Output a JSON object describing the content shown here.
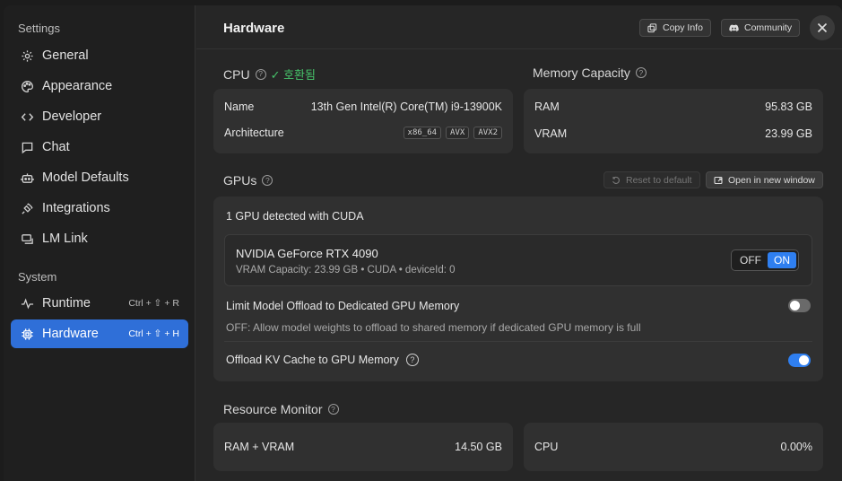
{
  "sidebar": {
    "settings_heading": "Settings",
    "system_heading": "System",
    "items": [
      {
        "label": "General",
        "icon": "gear-icon"
      },
      {
        "label": "Appearance",
        "icon": "palette-icon"
      },
      {
        "label": "Developer",
        "icon": "code-icon"
      },
      {
        "label": "Chat",
        "icon": "chat-icon"
      },
      {
        "label": "Model Defaults",
        "icon": "robot-icon"
      },
      {
        "label": "Integrations",
        "icon": "plug-icon"
      },
      {
        "label": "LM Link",
        "icon": "link-icon"
      }
    ],
    "system_items": [
      {
        "label": "Runtime",
        "shortcut": "Ctrl + ⇧ + R",
        "icon": "pulse-icon"
      },
      {
        "label": "Hardware",
        "shortcut": "Ctrl + ⇧ + H",
        "icon": "chip-icon",
        "active": true
      }
    ]
  },
  "header": {
    "title": "Hardware",
    "copy_info_label": "Copy Info",
    "community_label": "Community"
  },
  "cpu": {
    "title": "CPU",
    "status": "✓ 호환됨",
    "name_label": "Name",
    "name_value": "13th Gen Intel(R) Core(TM) i9-13900K",
    "arch_label": "Architecture",
    "arch_tags": [
      "x86_64",
      "AVX",
      "AVX2"
    ]
  },
  "memory": {
    "title": "Memory Capacity",
    "ram_label": "RAM",
    "ram_value": "95.83 GB",
    "vram_label": "VRAM",
    "vram_value": "23.99 GB"
  },
  "gpus": {
    "title": "GPUs",
    "reset_label": "Reset to default",
    "open_window_label": "Open in new window",
    "detected_text": "1 GPU detected with CUDA",
    "gpu_name": "NVIDIA GeForce RTX 4090",
    "gpu_details": "VRAM Capacity: 23.99 GB • CUDA • deviceId: 0",
    "off_label": "OFF",
    "on_label": "ON",
    "limit_offload_label": "Limit Model Offload to Dedicated GPU Memory",
    "limit_offload_desc": "OFF: Allow model weights to offload to shared memory if dedicated GPU memory is full",
    "kv_cache_label": "Offload KV Cache to GPU Memory"
  },
  "resource_monitor": {
    "title": "Resource Monitor",
    "ram_vram_label": "RAM + VRAM",
    "ram_vram_value": "14.50 GB",
    "cpu_label": "CPU",
    "cpu_value": "0.00%"
  }
}
